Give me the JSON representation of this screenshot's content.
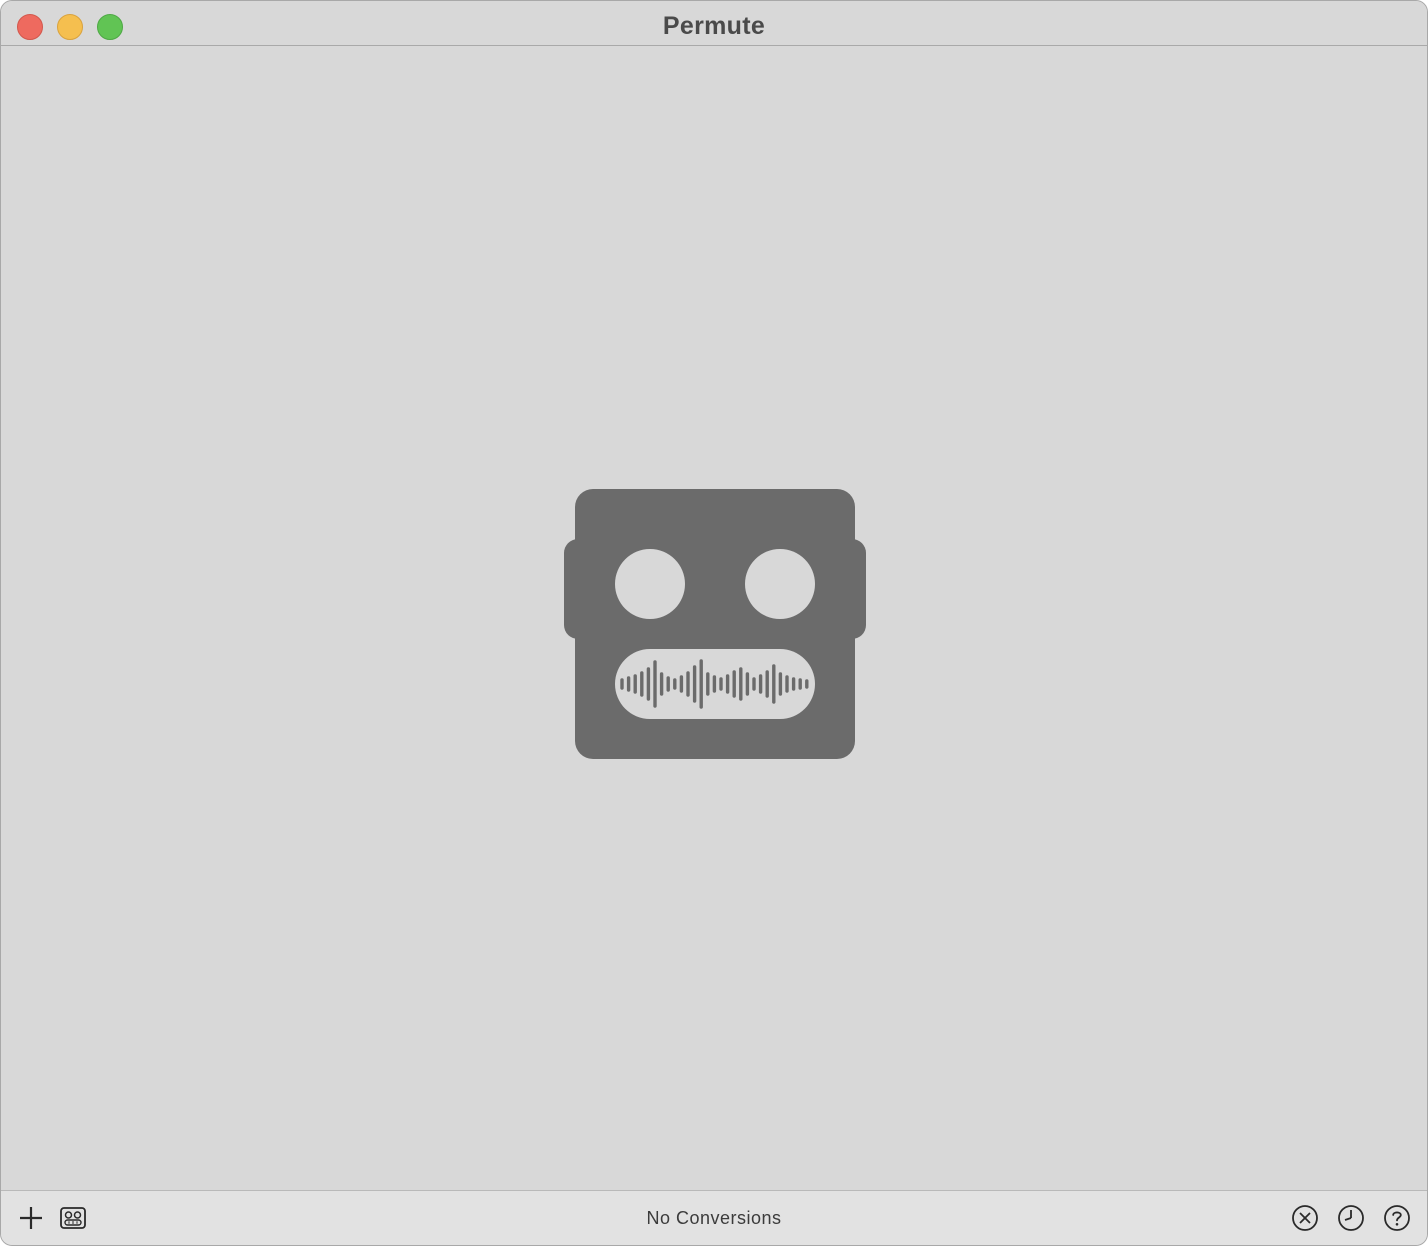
{
  "window": {
    "title": "Permute",
    "controls": {
      "close": {
        "icon": "close-icon",
        "color": "#ee6a5f"
      },
      "minimize": {
        "icon": "minimize-icon",
        "color": "#f5bf4f"
      },
      "zoom": {
        "icon": "zoom-icon",
        "color": "#61c454"
      }
    }
  },
  "main": {
    "placeholder_icon": "robot-waveform-icon",
    "icon_color": "#6b6b6b"
  },
  "bottom_bar": {
    "left_buttons": [
      {
        "icon": "plus-icon"
      },
      {
        "icon": "robot-icon"
      }
    ],
    "status_text": "No Conversions",
    "right_buttons": [
      {
        "icon": "close-circle-icon"
      },
      {
        "icon": "clock-icon"
      },
      {
        "icon": "help-icon"
      }
    ]
  }
}
